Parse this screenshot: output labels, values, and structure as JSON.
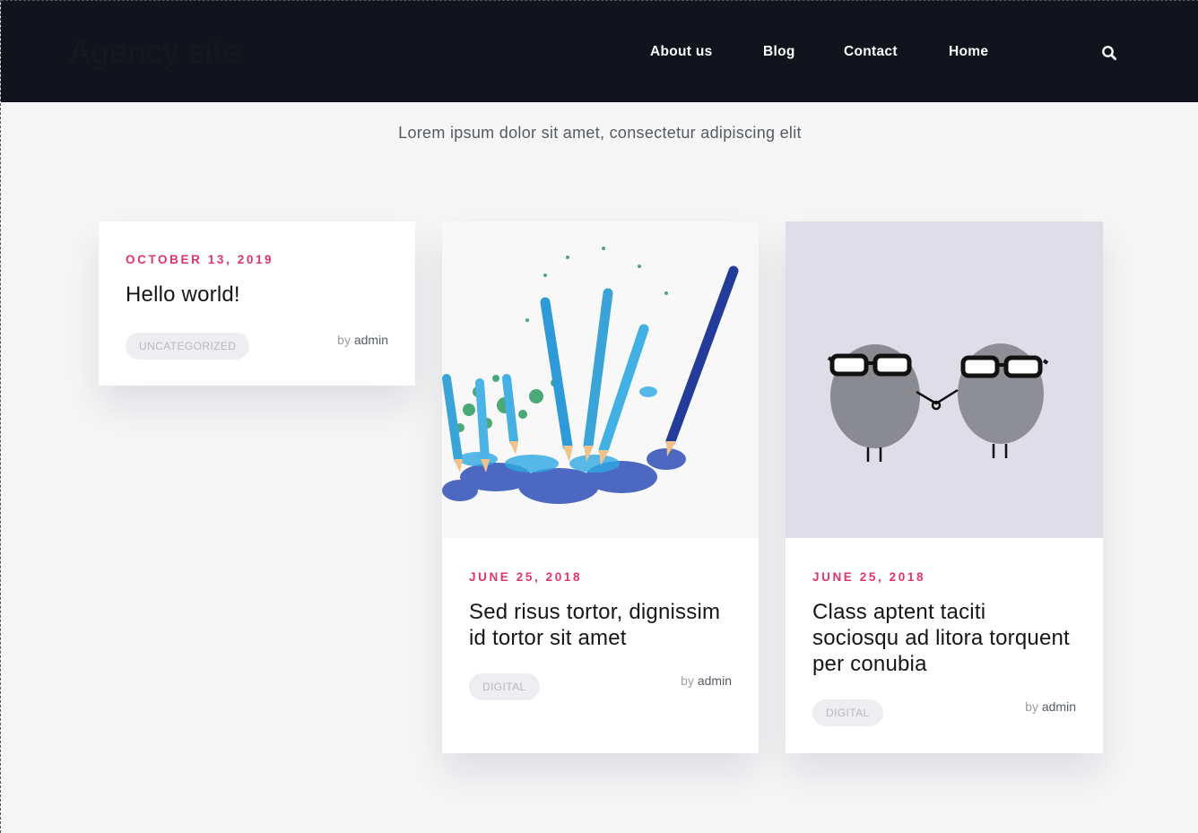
{
  "header": {
    "brand": "Agency site",
    "nav": [
      "About us",
      "Blog",
      "Contact",
      "Home"
    ]
  },
  "tagline": "Lorem ipsum dolor sit amet, consectetur adipiscing elit",
  "colors": {
    "header_bg": "#11141c",
    "accent": "#e0346e",
    "page_bg": "#f6f6f7"
  },
  "posts": [
    {
      "date": "OCTOBER 13, 2019",
      "title": "Hello world!",
      "tag": "UNCATEGORIZED",
      "by": "by",
      "author": "admin"
    },
    {
      "date": "JUNE 25, 2018",
      "title": "Sed risus tortor, dignissim id tortor sit amet",
      "tag": "DIGITAL",
      "by": "by",
      "author": "admin",
      "image": "colored-pencils-shavings-image"
    },
    {
      "date": "JUNE 25, 2018",
      "title": "Class aptent taciti sociosqu ad litora torquent per conubia",
      "tag": "DIGITAL",
      "by": "by",
      "author": "admin",
      "image": "stones-with-glasses-image"
    }
  ]
}
